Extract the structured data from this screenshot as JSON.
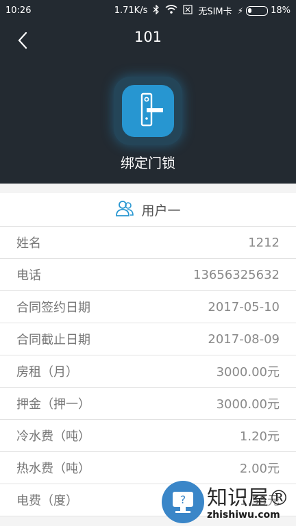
{
  "status_bar": {
    "time": "10:26",
    "speed": "1.71K/s",
    "sim": "无SIM卡",
    "battery": "18%"
  },
  "header": {
    "title": "101",
    "bind_label": "绑定门锁",
    "icon_color": "#2796d1"
  },
  "user_section": {
    "title": "用户一",
    "rows": [
      {
        "label": "姓名",
        "value": "1212"
      },
      {
        "label": "电话",
        "value": "13656325632"
      },
      {
        "label": "合同签约日期",
        "value": "2017-05-10"
      },
      {
        "label": "合同截止日期",
        "value": "2017-08-09"
      },
      {
        "label": "房租（月）",
        "value": "3000.00元"
      },
      {
        "label": "押金（押一）",
        "value": "3000.00元"
      },
      {
        "label": "冷水费（吨）",
        "value": "1.20元"
      },
      {
        "label": "热水费（吨）",
        "value": "2.00元"
      },
      {
        "label": "电费（度）",
        "value": "1.55元"
      }
    ]
  },
  "watermark": {
    "text": "知识屋®",
    "url": "zhishiwu.com"
  }
}
